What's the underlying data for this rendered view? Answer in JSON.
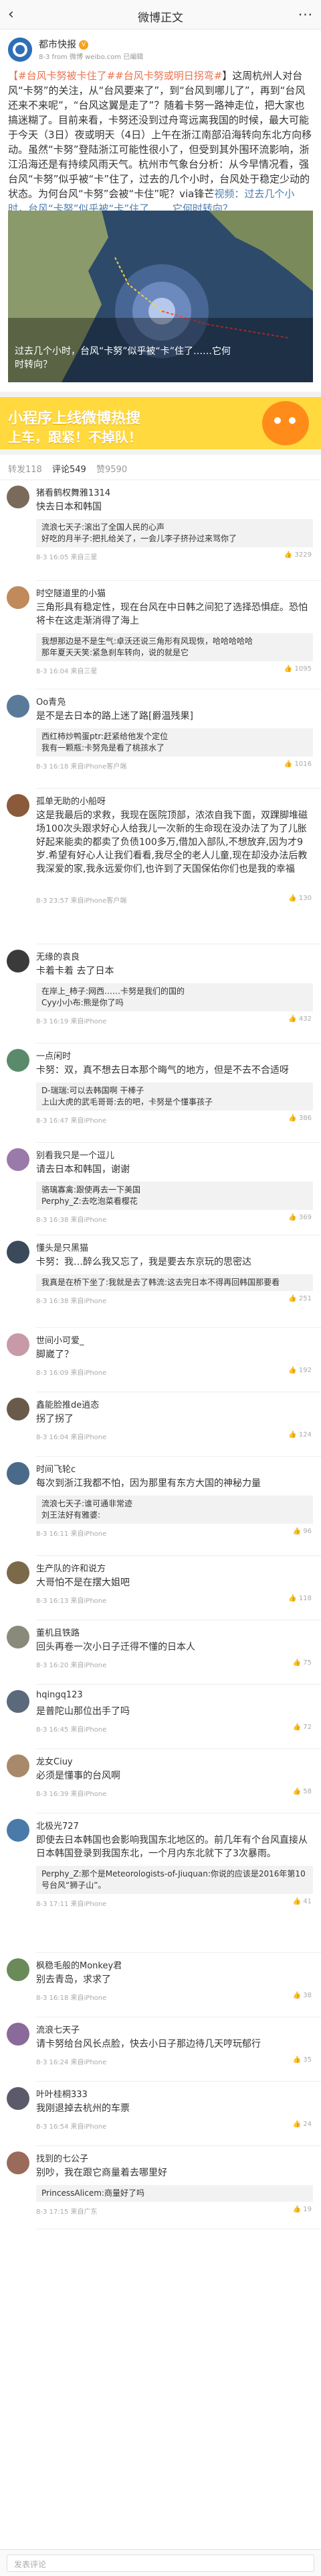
{
  "nav": {
    "title": "微博正文",
    "back": "‹",
    "more": "···"
  },
  "post": {
    "author": "都市快报",
    "badge": "V",
    "meta": "8-3 from 微博 weibo.com 已编辑",
    "text_parts": [
      {
        "t": "【#台风卡努被卡住了#",
        "c": "hl"
      },
      {
        "t": "#台风卡努或明日拐弯#",
        "c": "hl"
      },
      {
        "t": "】这周杭州人对台风“卡努”的关注，从“台风要来了”，到“台风到哪儿了”，再到“台风还来不来呢”，“台风这翼是走了”？随着卡努一路神走位，把大家也搞迷糊了。目前来看，卡努还没到过舟弯远离我国的时候，最大可能于今天（3日）夜或明天（4日）上午在浙江南部沿海转向东北方向移动。虽然“卡努”登陆浙江可能性很小了，但受到其外围环流影响，浙江沿海还是有持续风雨天气。杭州市气象台分析：从今早情况看，强台风“卡努”似乎被“卡”住了，过去的几个小时，台风处于稳定少动的状态。为何台风“卡努”会被“卡住”呢？via锋芒",
        "c": ""
      },
      {
        "t": "视频：过去几个小时，台风“卡努”似乎被“卡”住了…… 它何时转向？",
        "c": "lnk"
      }
    ],
    "image_caption": "过去几个小时，台风“卡努”似乎被“卡”住了……它何时转向？"
  },
  "banner": {
    "line1": "小程序上线微博热搜",
    "line2": "上车，跟紧！不掉队！"
  },
  "tabs": [
    {
      "label": "转发118"
    },
    {
      "label": "评论549"
    },
    {
      "label": "赞9590"
    }
  ],
  "comments": [
    {
      "name": "猪看鹤权舞雅1314",
      "text": "快去日本和韩国",
      "replies": [
        "流浪七天子:滚出了全国人民的心声",
        "好吃的月半子:把扎给关了，一会儿李子挤孙过来骂你了"
      ],
      "time": "8-3 16:05 来自三星",
      "likes": "3229",
      "color": "#7a6a5a"
    },
    {
      "name": "时空隧道里的小猫",
      "text": "三角形具有稳定性，现在台风在中日韩之间犯了选择恐惧症。恐怕将卡在这走渐消得了海上",
      "replies": [
        "我想那边是不是生气:卓沃还说三角形有风现恢，哈哈哈哈哈",
        "那年夏天天笑:紧急刹车转向，说的就是它"
      ],
      "time": "8-3 16:04 来自三星",
      "likes": "1095",
      "color": "#c08a5a"
    },
    {
      "name": "Oo青凫",
      "text": "是不是去日本的路上迷了路[爵温残果]",
      "replies": [
        "西红柿炒鸭蛋ptr:赶紧给他发个定位",
        "我有一颗瓶:卡努凫是看了桃孩水了"
      ],
      "time": "8-3 16:18 来自iPhone客户端",
      "likes": "1016",
      "color": "#5a7a9a"
    },
    {
      "name": "孤单无助的小船呀",
      "text": "这是我最后的求救，我现在医院顶部，浓浓自我下面，双踝脚堆磁场100次头跟求好心人给我儿一次新的生命现在没办法了为了儿胀好起来能卖的都卖了负债100多万,借加入部队,不想放弃,因为才9岁.希望有好心人让我们看看,我尽全的老人儿童,现在却没办法后教我深爱的家,我永远爱你们,也许到了天国保佑你们也是我的幸福",
      "replies": [],
      "time": "8-3 23:57 来自iPhone客户端",
      "likes": "130",
      "color": "#8a5a3a"
    },
    {
      "name": "无缘的袁良",
      "text": "卡着卡着 去了日本",
      "replies": [
        "在岸上_柿子:网西……卡努是我们的国的",
        "Cyy小小布:熊是你了吗"
      ],
      "time": "8-3 16:19 来自iPhone",
      "likes": "432",
      "color": "#3a3a3a"
    },
    {
      "name": "一点闲时",
      "text": "卡努：双，真不想去日本那个晦气的地方，但是不去不合适呀",
      "replies": [
        "D-瑞瑞:可以去韩国啊 干棒子",
        "上山大虎的武毛哥哥:去的吧，卡努是个懂事孩子"
      ],
      "time": "8-3 16:47 来自iPhone",
      "likes": "386",
      "color": "#5a8a6a"
    },
    {
      "name": "别看我只是一个逗儿",
      "text": "请去日本和韩国，谢谢",
      "replies": [
        "骆璃寡禽:跟使再去一下美国",
        "Perphy_Z:去吃泡菜看樱花"
      ],
      "time": "8-3 16:38 来自iPhone",
      "likes": "369",
      "color": "#9a7aa8"
    },
    {
      "name": "懂头是只黑猫",
      "text": "卡努：我…醉么我又忘了，我是要去东京玩的思密达",
      "replies": [
        "我真是在桥下坐了:我就是去了韩流:这去完日本不得再回韩国那要看"
      ],
      "time": "8-3 16:38 来自iPhone",
      "likes": "251",
      "color": "#3a4a5a"
    },
    {
      "name": "世间小可爱_",
      "text": "脚崴了？",
      "replies": [],
      "time": "8-3 16:09 来自iPhone",
      "likes": "192",
      "color": "#c89aa8"
    },
    {
      "name": "鑫能脸推de逍态",
      "text": "拐了拐了",
      "replies": [],
      "time": "8-3 16:04 来自iPhone",
      "likes": "124",
      "color": "#6a5a4a"
    },
    {
      "name": "时间飞轮c",
      "text": "每次到浙江我都不怕，因为那里有东方大国的神秘力量",
      "replies": [
        "流浪七天子:谁可通非常迹",
        "刘王法好有雅婆:"
      ],
      "time": "8-3 16:11 来自iPhone",
      "likes": "96",
      "color": "#4a6a8a"
    },
    {
      "name": "生产队的许和说方",
      "text": "大哥怕不是在摆大姐吧",
      "replies": [],
      "time": "8-3 16:13 来自iPhone",
      "likes": "118",
      "color": "#7a6a4a"
    },
    {
      "name": "董机且铁路",
      "text": "回头再卷一次小日子迁得不懂的日本人",
      "replies": [],
      "time": "8-3 16:20 来自iPhone",
      "likes": "75",
      "color": "#8a8a7a"
    },
    {
      "name": "hqingq123",
      "text": "是普陀山那位出手了吗",
      "replies": [],
      "time": "8-3 16:45 来自iPhone",
      "likes": "72",
      "color": "#5a6a7a"
    },
    {
      "name": "龙女Ciuy",
      "text": "必须是懂事的台风啊",
      "replies": [],
      "time": "8-3 16:39 来自iPhone",
      "likes": "58",
      "color": "#a88a6a"
    },
    {
      "name": "北极光727",
      "text": "即使去日本韩国也会影响我国东北地区的。前几年有个台风直接从日本韩国登录到我国东北，一个月内东北就下了3次暴雨。",
      "replies": [
        "Perphy_Z:那个是Meteorologists-of-Jiuquan:你说的应该是2016年第10号台风“狮子山”。"
      ],
      "time": "8-3 17:11 来自iPhone",
      "likes": "41",
      "color": "#4a7aa8"
    },
    {
      "name": "枫稳毛般的Monkey君",
      "text": "别去青岛，求求了",
      "replies": [],
      "time": "8-3 16:18 来自iPhone",
      "likes": "38",
      "color": "#6a8a5a"
    },
    {
      "name": "流浪七天子",
      "text": "请卡努给台风长点脸，快去小日子那边待几天哼玩郁行",
      "replies": [],
      "time": "8-3 16:24 来自iPhone",
      "likes": "35",
      "color": "#8a6a9a"
    },
    {
      "name": "叶叶桂桐333",
      "text": "我刚退掉去杭州的车票",
      "replies": [],
      "time": "8-3 16:54 来自iPhone",
      "likes": "24",
      "color": "#5a5a6a"
    },
    {
      "name": "找到的七公子",
      "text": "别吵，我在跟它商量着去哪里好",
      "replies": [
        "PrincessAlicem:商量好了吗"
      ],
      "time": "8-3 17:15 来自广东",
      "likes": "19",
      "color": "#9a6a5a"
    }
  ],
  "bottom": {
    "placeholder": "发表评论"
  }
}
